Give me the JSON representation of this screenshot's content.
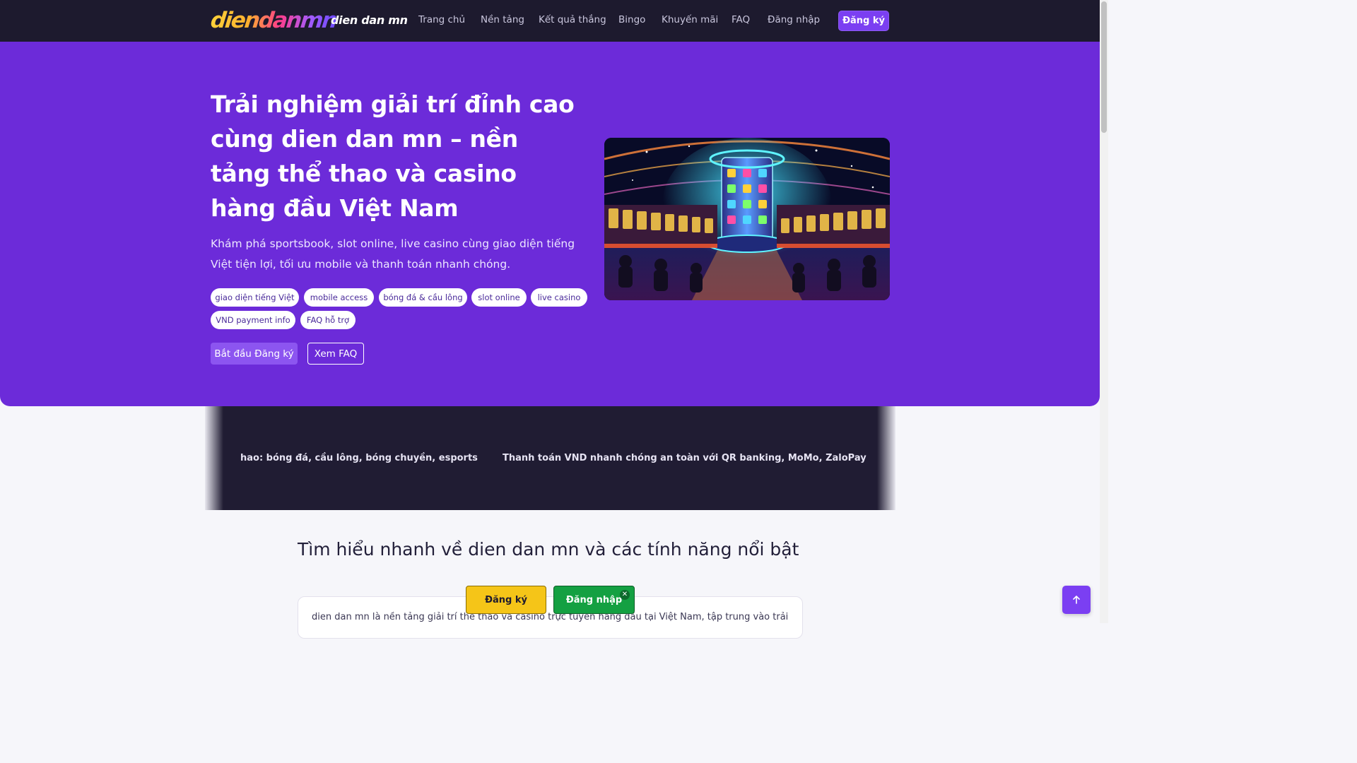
{
  "header": {
    "logo_text": "diendanmn",
    "site_name": "dien dan mn",
    "nav": [
      "Trang chủ",
      "Nền tảng",
      "Kết quả thắng",
      "Bingo",
      "Khuyến mãi",
      "FAQ",
      "Đăng nhập"
    ],
    "register_label": "Đăng ký"
  },
  "hero": {
    "title": "Trải nghiệm giải trí đỉnh cao cùng dien dan mn – nền tảng thể thao và casino hàng đầu Việt Nam",
    "subtitle": "Khám phá sportsbook, slot online, live casino cùng giao diện tiếng Việt tiện lợi, tối ưu mobile và thanh toán nhanh chóng.",
    "chips": [
      "giao diện tiếng Việt",
      "mobile access",
      "bóng đá & cầu lông",
      "slot online",
      "live casino",
      "VND payment info",
      "FAQ hỗ trợ"
    ],
    "btn_start": "Bắt đầu Đăng ký",
    "btn_faq": "Xem FAQ"
  },
  "ticker": {
    "item1": "hao: bóng đá, cầu lông, bóng chuyền, esports",
    "item2": "Thanh toán VND nhanh chóng an toàn với QR banking, MoMo, ZaloPay"
  },
  "section": {
    "title": "Tìm hiểu nhanh về dien dan mn và các tính năng nổi bật",
    "body": "dien dan mn là nền tảng giải trí thể thao và casino trực tuyến hàng đầu tại Việt Nam, tập trung vào trải"
  },
  "floating": {
    "register": "Đăng ký",
    "login": "Đăng nhập",
    "close": "✕"
  },
  "colors": {
    "accent": "#7b3ff2",
    "hero_bg": "#6c2bd9",
    "header_bg": "#1d1a2e",
    "yellow_button": "#f5c518",
    "green_button": "#14a042"
  }
}
